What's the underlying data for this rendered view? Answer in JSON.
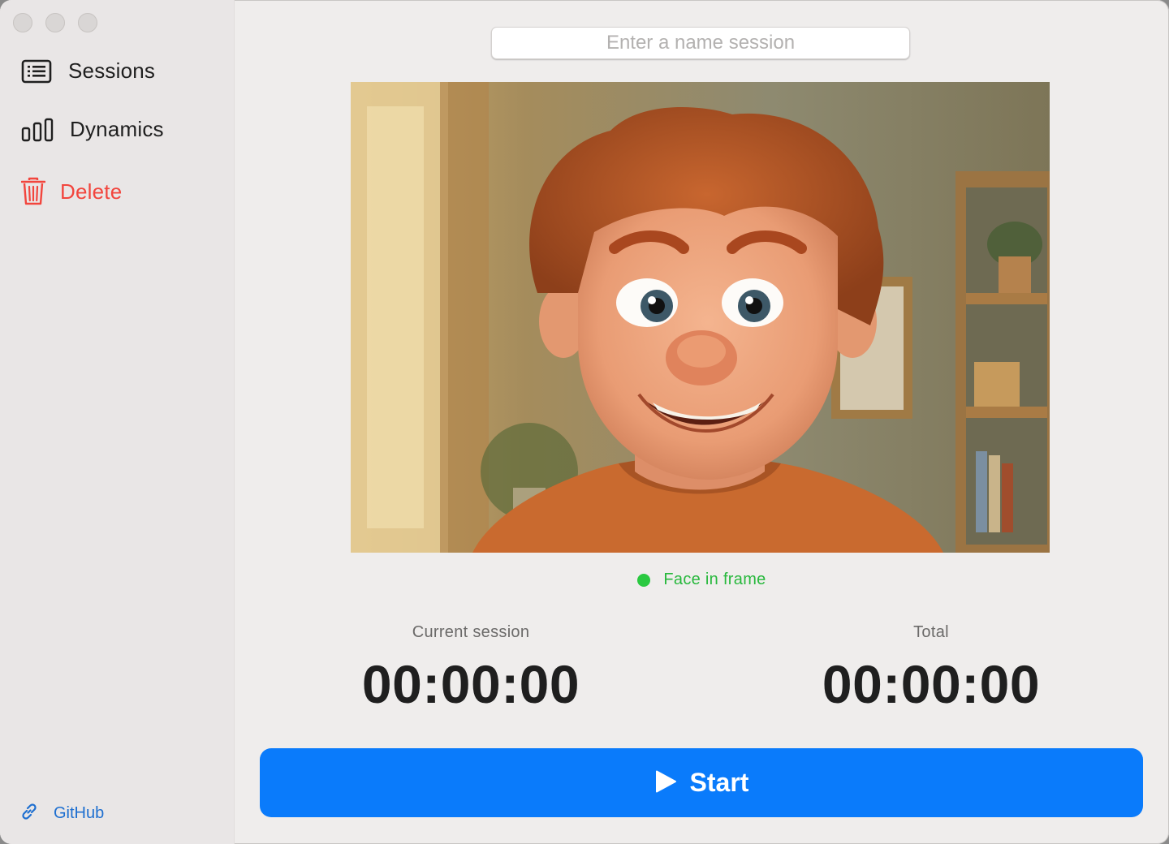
{
  "window": {
    "controls": [
      "close",
      "minimize",
      "zoom"
    ]
  },
  "sidebar": {
    "items": [
      {
        "label": "Sessions",
        "icon": "list-icon"
      },
      {
        "label": "Dynamics",
        "icon": "bar-chart-icon"
      },
      {
        "label": "Delete",
        "icon": "trash-icon",
        "color": "#f2453d"
      }
    ],
    "footer_link": {
      "label": "GitHub",
      "icon": "link-icon",
      "color": "#1e6fd0"
    }
  },
  "main": {
    "session_name": {
      "value": "",
      "placeholder": "Enter a name session"
    },
    "camera": {
      "description_icon": "camera-preview"
    },
    "status": {
      "label": "Face in frame",
      "color": "#2ac940"
    },
    "timers": {
      "current": {
        "caption": "Current session",
        "value": "00:00:00"
      },
      "total": {
        "caption": "Total",
        "value": "00:00:00"
      }
    },
    "start_button": {
      "label": "Start",
      "icon": "play-icon",
      "color": "#0a7bfb"
    }
  }
}
